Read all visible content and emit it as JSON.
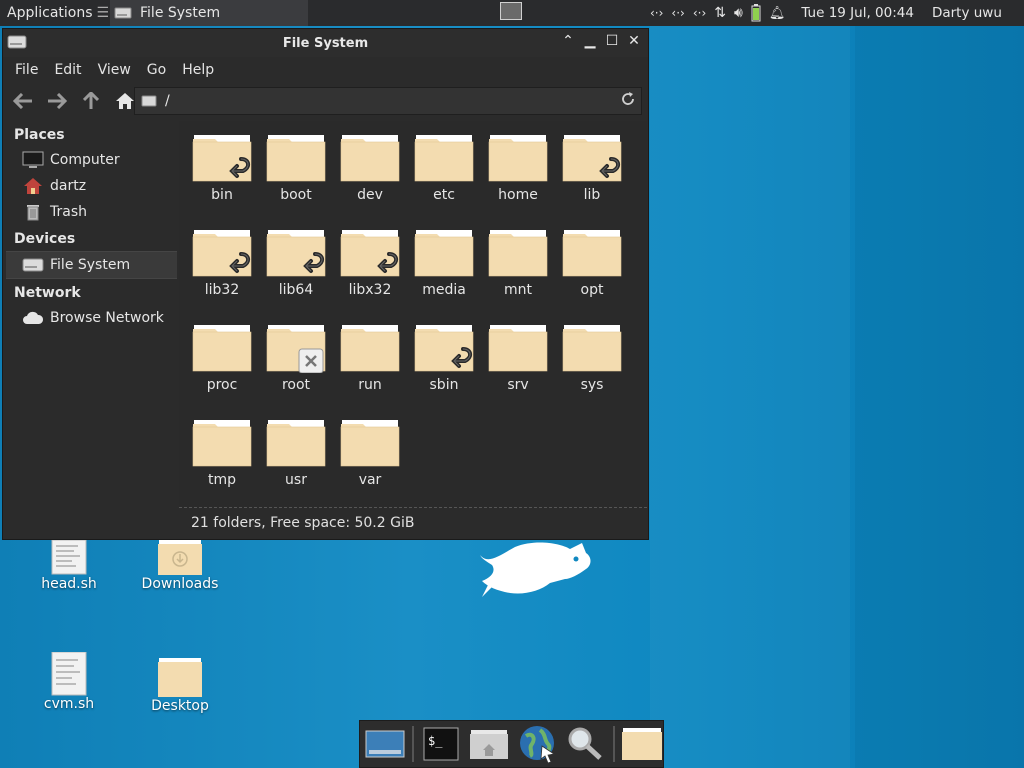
{
  "top_panel": {
    "applications_label": "Applications",
    "task_label": "File System",
    "clock": "Tue 19 Jul, 00:44",
    "user": "Darty uwu"
  },
  "window": {
    "title": "File System",
    "menu": [
      "File",
      "Edit",
      "View",
      "Go",
      "Help"
    ],
    "location_path": "/",
    "status": "21 folders, Free space: 50.2 GiB"
  },
  "sidebar": {
    "places_heading": "Places",
    "places": [
      "Computer",
      "dartz",
      "Trash"
    ],
    "devices_heading": "Devices",
    "devices": [
      "File System"
    ],
    "network_heading": "Network",
    "network": [
      "Browse Network"
    ]
  },
  "folders": [
    {
      "name": "bin",
      "symlink": true
    },
    {
      "name": "boot",
      "symlink": false
    },
    {
      "name": "dev",
      "symlink": false
    },
    {
      "name": "etc",
      "symlink": false
    },
    {
      "name": "home",
      "symlink": false
    },
    {
      "name": "lib",
      "symlink": true
    },
    {
      "name": "lib32",
      "symlink": true
    },
    {
      "name": "lib64",
      "symlink": true
    },
    {
      "name": "libx32",
      "symlink": true
    },
    {
      "name": "media",
      "symlink": false
    },
    {
      "name": "mnt",
      "symlink": false
    },
    {
      "name": "opt",
      "symlink": false
    },
    {
      "name": "proc",
      "symlink": false
    },
    {
      "name": "root",
      "locked": true
    },
    {
      "name": "run",
      "symlink": false
    },
    {
      "name": "sbin",
      "symlink": true
    },
    {
      "name": "srv",
      "symlink": false
    },
    {
      "name": "sys",
      "symlink": false
    },
    {
      "name": "tmp",
      "symlink": false
    },
    {
      "name": "usr",
      "symlink": false
    },
    {
      "name": "var",
      "symlink": false
    }
  ],
  "desktop_icons": [
    "head.sh",
    "Downloads",
    "cvm.sh",
    "Desktop"
  ],
  "colors": {
    "folder_body": "#f3dcb0",
    "folder_tab": "#ffffff",
    "desktop_bg": "#1088c0"
  }
}
